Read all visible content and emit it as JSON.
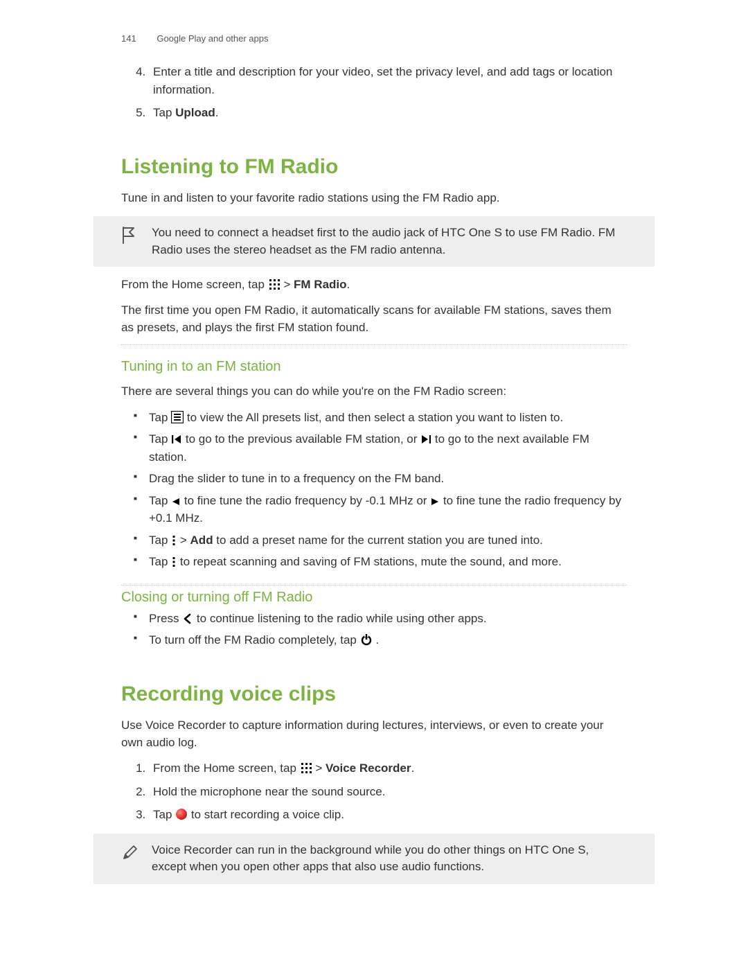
{
  "header": {
    "page_number": "141",
    "chapter": "Google Play and other apps"
  },
  "continued_steps": {
    "start": 4,
    "items": [
      {
        "pre": "Enter a title and description for your video, set the privacy level, and add tags or location information."
      },
      {
        "pre": "Tap ",
        "bold": "Upload",
        "post": "."
      }
    ]
  },
  "fm_radio": {
    "title": "Listening to FM Radio",
    "intro": "Tune in and listen to your favorite radio stations using the FM Radio app.",
    "note": "You need to connect a headset first to the audio jack of HTC One S to use FM Radio. FM Radio uses the stereo headset as the FM radio antenna.",
    "launch": {
      "pre": "From the Home screen, tap ",
      "mid": " > ",
      "bold": "FM Radio",
      "post": "."
    },
    "firsttime": "The first time you open FM Radio, it automatically scans for available FM stations, saves them as presets, and plays the first FM station found.",
    "tuning_title": "Tuning in to an FM station",
    "tuning_intro": "There are several things you can do while you're on the FM Radio screen:",
    "tuning_items": {
      "i1": {
        "pre": "Tap ",
        "post": " to view the All presets list, and then select a station you want to listen to."
      },
      "i2": {
        "pre": "Tap ",
        "mid": " to go to the previous available FM station, or ",
        "post": " to go to the next available FM station."
      },
      "i3": {
        "text": "Drag the slider to tune in to a frequency on the FM band."
      },
      "i4": {
        "pre": "Tap ",
        "mid": " to fine tune the radio frequency by -0.1 MHz or ",
        "post": " to fine tune the radio frequency by +0.1 MHz."
      },
      "i5": {
        "pre": "Tap ",
        "mid": " > ",
        "bold": "Add",
        "post": " to add a preset name for the current station you are tuned into."
      },
      "i6": {
        "pre": "Tap ",
        "post": " to repeat scanning and saving of FM stations, mute the sound, and more."
      }
    },
    "closing_title": "Closing or turning off FM Radio",
    "closing_items": {
      "c1": {
        "pre": "Press ",
        "post": " to continue listening to the radio while using other apps."
      },
      "c2": {
        "pre": "To turn off the FM Radio completely, tap ",
        "post": "."
      }
    }
  },
  "voice": {
    "title": "Recording voice clips",
    "intro": "Use Voice Recorder to capture information during lectures, interviews, or even to create your own audio log.",
    "steps": {
      "s1": {
        "pre": "From the Home screen, tap ",
        "mid": " > ",
        "bold": "Voice Recorder",
        "post": "."
      },
      "s2": {
        "text": "Hold the microphone near the sound source."
      },
      "s3": {
        "pre": "Tap ",
        "post": " to start recording a voice clip."
      }
    },
    "note": "Voice Recorder can run in the background while you do other things on HTC One S, except when you open other apps that also use audio functions."
  }
}
